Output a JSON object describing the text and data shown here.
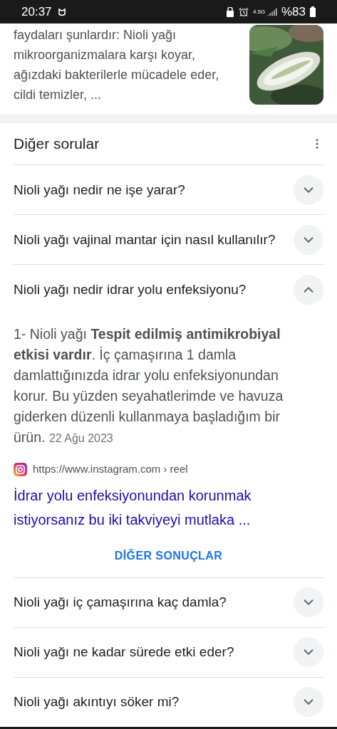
{
  "status_bar": {
    "time": "20:37",
    "battery": "%83",
    "network": "4.5G"
  },
  "snippet": {
    "text": "faydaları şunlardır: Nioli yağı mikroorganizmalara karşı koyar, ağızdaki bakterilerle mücadele eder, cildi temizler, ..."
  },
  "questions_header": {
    "title": "Diğer sorular"
  },
  "questions": [
    {
      "text": "Nioli yağı nedir ne işe yarar?",
      "expanded": false
    },
    {
      "text": "Nioli yağı vajinal mantar için nasıl kullanılır?",
      "expanded": false
    },
    {
      "text": "Nioli yağı nedir idrar yolu enfeksiyonu?",
      "expanded": true,
      "answer": "1- Nioli yağı **Tespit edilmiş antimikrobiyal etkisi vardır**. İç çamaşırına 1 damla damlattığınızda idrar yolu enfeksiyonundan korur. Bu yüzden seyahatlerimde ve havuza giderken düzenli kullanmaya başladığım bir ürün.",
      "date": "22 Ağu 2023",
      "source_url": "https://www.instagram.com › reel",
      "link_title": "İdrar yolu enfeksiyonundan korunmak istiyorsanız bu iki takviyeyi mutlaka ..."
    }
  ],
  "more_button": "DİĞER SONUÇLAR",
  "more_questions": [
    {
      "text": "Nioli yağı iç çamaşırına kaç damla?",
      "expanded": false
    },
    {
      "text": "Nioli yağı ne kadar sürede etki eder?",
      "expanded": false
    },
    {
      "text": "Nioli yağı akıntıyı söker mi?",
      "expanded": false
    }
  ]
}
